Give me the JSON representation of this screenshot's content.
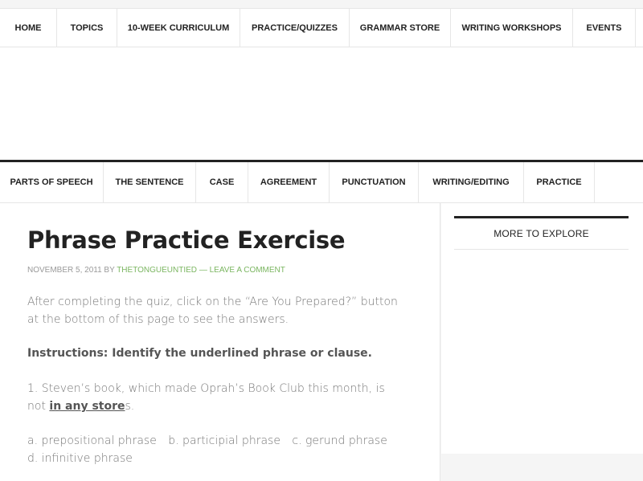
{
  "primary_nav": [
    {
      "label": "HOME",
      "name": "nav-home"
    },
    {
      "label": "TOPICS",
      "name": "nav-topics"
    },
    {
      "label": "10-WEEK CURRICULUM",
      "name": "nav-curriculum"
    },
    {
      "label": "PRACTICE/QUIZZES",
      "name": "nav-practice-quizzes"
    },
    {
      "label": "GRAMMAR STORE",
      "name": "nav-grammar-store"
    },
    {
      "label": "WRITING WORKSHOPS",
      "name": "nav-writing-workshops"
    },
    {
      "label": "EVENTS",
      "name": "nav-events"
    }
  ],
  "secondary_nav": [
    {
      "label": "PARTS OF SPEECH",
      "name": "nav-parts-of-speech"
    },
    {
      "label": "THE SENTENCE",
      "name": "nav-the-sentence"
    },
    {
      "label": "CASE",
      "name": "nav-case"
    },
    {
      "label": "AGREEMENT",
      "name": "nav-agreement"
    },
    {
      "label": "PUNCTUATION",
      "name": "nav-punctuation"
    },
    {
      "label": "WRITING/EDITING",
      "name": "nav-writing-editing"
    },
    {
      "label": "PRACTICE",
      "name": "nav-practice"
    }
  ],
  "post": {
    "title": "Phrase Practice Exercise",
    "date": "NOVEMBER 5, 2011",
    "by": "BY",
    "author": "THETONGUEUNTIED",
    "separator": "—",
    "comment_link": "LEAVE A COMMENT",
    "intro": "After completing the quiz, click on the “Are You Prepared?” button at the bottom of this page to see the answers.",
    "instructions": "Instructions: Identify the underlined phrase or clause.",
    "q1_before": "1. Steven’s book, which made Oprah’s Book Club this month, is not ",
    "q1_underlined": "in any store",
    "q1_after": "s.",
    "options": [
      "a. prepositional phrase",
      "b. participial phrase",
      "c. gerund phrase",
      "d. infinitive phrase"
    ]
  },
  "sidebar": {
    "heading": "MORE TO EXPLORE"
  }
}
